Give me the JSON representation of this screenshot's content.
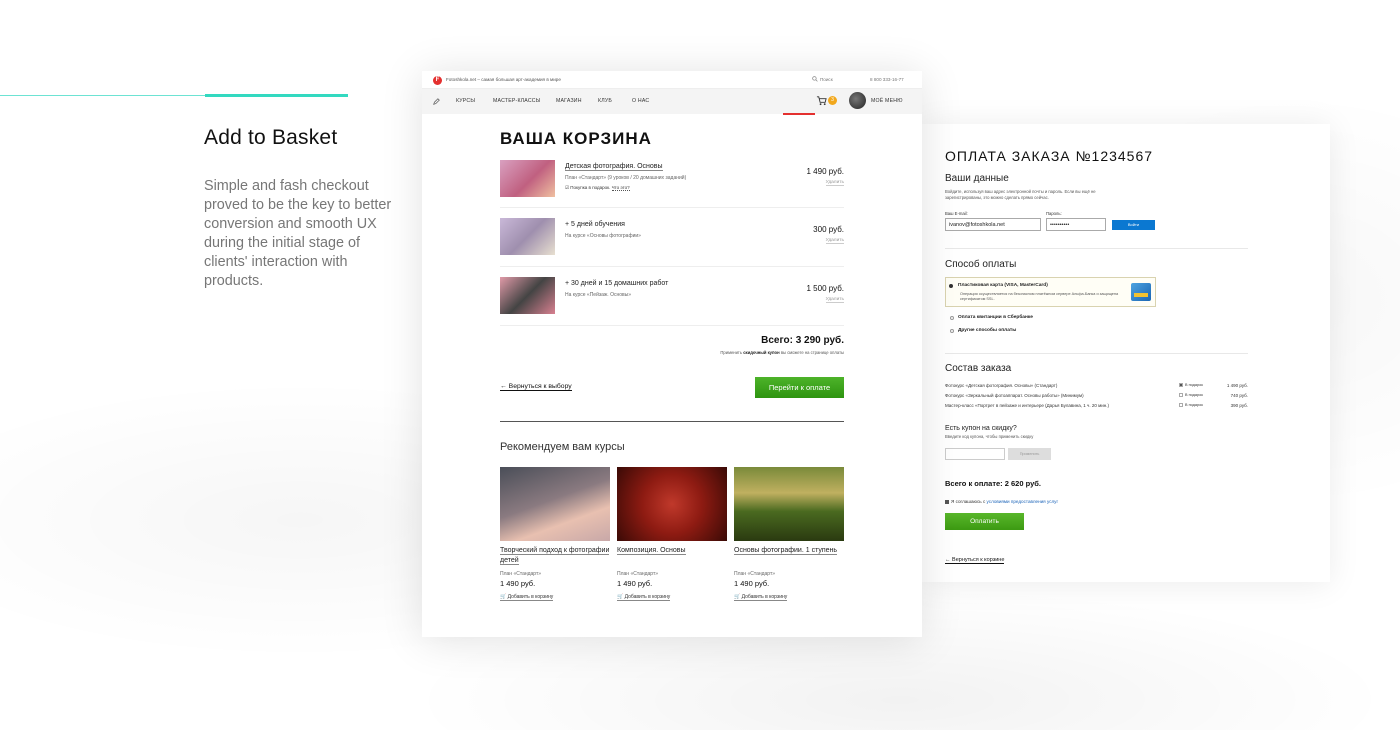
{
  "intro": {
    "title": "Add to Basket",
    "description": "Simple and fash checkout proved to be the key to better conversion and smooth UX during the initial stage of clients' interaction with products."
  },
  "colors": {
    "accent": "#33d9c0",
    "brand_red": "#e4302f",
    "green": "#3c9a12",
    "blue": "#0b78d1",
    "badge": "#f2a81c"
  },
  "site": {
    "logo_letter": "F",
    "tagline": "Fotoshkola.net – самая большая арт-академия в мире",
    "search_label": "Поиск",
    "phone": "8 800 333-16-77",
    "nav": [
      "КУРСЫ",
      "МАСТЕР-КЛАССЫ",
      "МАГАЗИН",
      "КЛУБ",
      "О НАС"
    ],
    "cart_count": "3",
    "my_menu": "МОЁ МЕНЮ"
  },
  "cart": {
    "title": "ВАША КОРЗИНА",
    "items": [
      {
        "name": "Детская фотография. Основы",
        "plan": "План «Стандарт» (9 уроков / 20 домашних заданий)",
        "gift": "Покупка в подарок.",
        "gift_q": "Что это?",
        "price": "1 490 руб.",
        "delete": "Удалить"
      },
      {
        "name": "+ 5 дней обучения",
        "plan": "На курсе «Основы фотографии»",
        "price": "300 руб.",
        "delete": "Удалить"
      },
      {
        "name": "+ 30 дней и 15 домашних работ",
        "plan": "На курсе «Пейзаж. Основы»",
        "price": "1 500 руб.",
        "delete": "Удалить"
      }
    ],
    "total": "Всего: 3 290 руб.",
    "coupon_note_pre": "Применить",
    "coupon_note_bold": "скидочный купон",
    "coupon_note_post": "вы сможете на странице оплаты",
    "back_link": "← Вернуться к выбору",
    "pay_button": "Перейти к оплате"
  },
  "recommended": {
    "title": "Рекомендуем вам курсы",
    "cards": [
      {
        "name": "Творческий подход к фотографии детей",
        "plan": "План «Стандарт»",
        "price": "1 490 руб.",
        "add": "Добавить в корзину"
      },
      {
        "name": "Композиция. Основы",
        "plan": "План «Стандарт»",
        "price": "1 490 руб.",
        "add": "Добавить в корзину"
      },
      {
        "name": "Основы фотографии. 1 ступень",
        "plan": "План «Стандарт»",
        "price": "1 490 руб.",
        "add": "Добавить в корзину"
      }
    ]
  },
  "payment": {
    "title": "ОПЛАТА ЗАКАЗА №1234567",
    "your_data": "Ваши данные",
    "login_note": "Войдите, используя ваш адрес электронной почты и пароль. Если вы ещё не зарегистрированы, это можно сделать прямо сейчас.",
    "email_label": "Ваш E-mail:",
    "email_value": "ivanov@fotoshkola.net",
    "password_label": "Пароль:",
    "password_value": "••••••••••",
    "login_button": "Войти",
    "method_title": "Способ оплаты",
    "card_option": "Пластиковая карта (VISA, MasterCard)",
    "card_desc": "Операция осуществляется на безопасном платёжном сервере Альфа-Банка и защищена сертификатом SSL.",
    "option_sber": "Оплата квитанции в Сбербанке",
    "option_other": "Другие способы оплаты",
    "order_title": "Состав заказа",
    "order_rows": [
      {
        "name": "Фотокурс «Детская фотография. Основы» (Стандарт)",
        "gift": "В подарок",
        "price": "1 490 руб."
      },
      {
        "name": "Фотокурс «Зеркальный фотоаппарат. Основы работы» (Минимум)",
        "gift": "В подарок",
        "price": "740 руб."
      },
      {
        "name": "Мастер-класс «Портрет в пейзаже и интерьере (Дарья Булавина, 1 ч. 20 мин.)",
        "gift": "В подарок",
        "price": "390 руб."
      }
    ],
    "coupon_title": "Есть купон на скидку?",
    "coupon_note": "Введите код купона, чтобы применить скидку",
    "coupon_button": "Применить",
    "total": "Всего к оплате: 2 620 руб.",
    "agree_pre": "Я соглашаюсь с",
    "agree_link": "условиями предоставления услуг",
    "pay_button": "Оплатить",
    "back": "← Вернуться к корзине"
  }
}
